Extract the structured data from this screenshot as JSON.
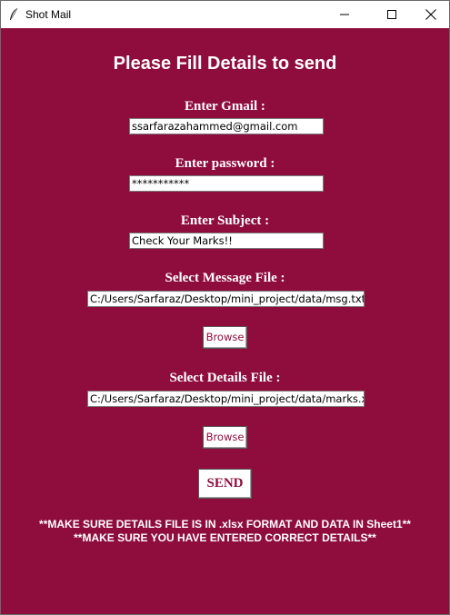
{
  "window": {
    "title": "Shot Mail",
    "controls": {
      "minimize_icon": "minimize-icon",
      "maximize_icon": "maximize-icon",
      "close_icon": "close-icon"
    }
  },
  "colors": {
    "background": "#8f0d3d",
    "text": "#ffffff",
    "button_text": "#8f0d3d"
  },
  "form": {
    "heading": "Please Fill Details to send",
    "gmail": {
      "label": "Enter Gmail :",
      "value": "ssarfarazahammed@gmail.com"
    },
    "password": {
      "label": "Enter password :",
      "value": "***********"
    },
    "subject": {
      "label": "Enter Subject :",
      "value": "Check Your Marks!!"
    },
    "message_file": {
      "label": "Select Message File :",
      "value": "C:/Users/Sarfaraz/Desktop/mini_project/data/msg.txt",
      "browse_label": "Browse"
    },
    "details_file": {
      "label": "Select Details File :",
      "value": "C:/Users/Sarfaraz/Desktop/mini_project/data/marks.xlsx",
      "browse_label": "Browse"
    },
    "send_label": "SEND"
  },
  "notes": {
    "line1": "**MAKE SURE DETAILS FILE IS IN .xlsx FORMAT AND DATA IN Sheet1**",
    "line2": "**MAKE SURE YOU HAVE ENTERED CORRECT DETAILS**"
  }
}
